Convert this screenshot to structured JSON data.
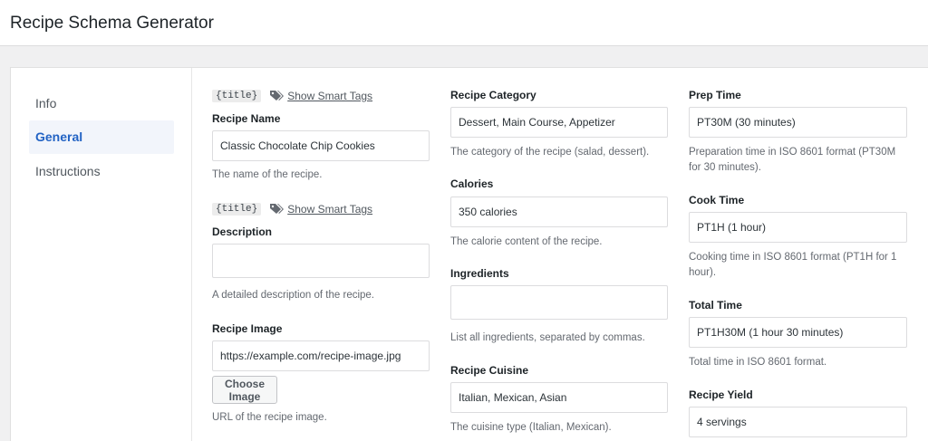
{
  "header": {
    "title": "Recipe Schema Generator"
  },
  "sidebar": {
    "items": [
      {
        "label": "Info",
        "active": false
      },
      {
        "label": "General",
        "active": true
      },
      {
        "label": "Instructions",
        "active": false
      }
    ]
  },
  "smart_tags": {
    "code": "{title}",
    "link_label": "Show Smart Tags"
  },
  "fields": {
    "recipe_name": {
      "label": "Recipe Name",
      "value": "Classic Chocolate Chip Cookies",
      "help": "The name of the recipe."
    },
    "description": {
      "label": "Description",
      "value": "",
      "help": "A detailed description of the recipe."
    },
    "recipe_image": {
      "label": "Recipe Image",
      "value": "https://example.com/recipe-image.jpg",
      "button": "Choose Image",
      "help": "URL of the recipe image."
    },
    "recipe_category": {
      "label": "Recipe Category",
      "value": "Dessert, Main Course, Appetizer",
      "help": "The category of the recipe (salad, dessert)."
    },
    "calories": {
      "label": "Calories",
      "value": "350 calories",
      "help": "The calorie content of the recipe."
    },
    "ingredients": {
      "label": "Ingredients",
      "value": "",
      "help": "List all ingredients, separated by commas."
    },
    "recipe_cuisine": {
      "label": "Recipe Cuisine",
      "value": "Italian, Mexican, Asian",
      "help": "The cuisine type (Italian, Mexican)."
    },
    "prep_time": {
      "label": "Prep Time",
      "value": "PT30M (30 minutes)",
      "help": "Preparation time in ISO 8601 format (PT30M for 30 minutes)."
    },
    "cook_time": {
      "label": "Cook Time",
      "value": "PT1H (1 hour)",
      "help": "Cooking time in ISO 8601 format (PT1H for 1 hour)."
    },
    "total_time": {
      "label": "Total Time",
      "value": "PT1H30M (1 hour 30 minutes)",
      "help": "Total time in ISO 8601 format."
    },
    "recipe_yield": {
      "label": "Recipe Yield",
      "value": "4 servings"
    }
  },
  "icons": {
    "tag": "tags-icon"
  },
  "colors": {
    "accent": "#2263c4",
    "active_bg": "#f2f5fb"
  }
}
